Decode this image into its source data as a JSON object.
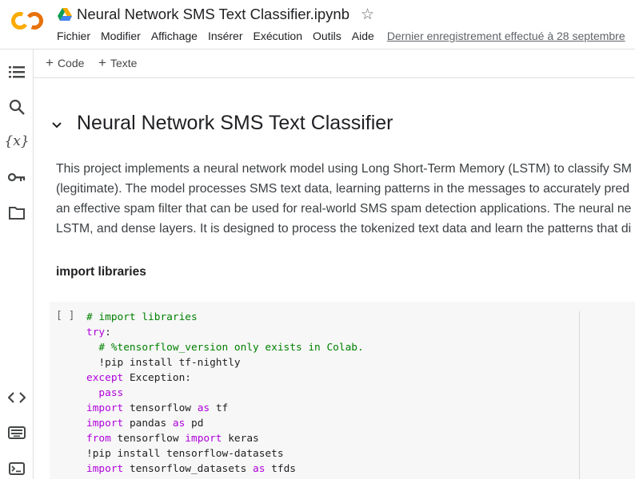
{
  "header": {
    "title": "Neural Network SMS Text Classifier.ipynb",
    "menu": [
      "Fichier",
      "Modifier",
      "Affichage",
      "Insérer",
      "Exécution",
      "Outils",
      "Aide"
    ],
    "last_saved": "Dernier enregistrement effectué à 28 septembre"
  },
  "rail": {
    "icons": [
      "table-of-contents-icon",
      "search-icon",
      "variables-icon",
      "secrets-key-icon",
      "files-folder-icon",
      "code-snippets-icon",
      "command-palette-icon",
      "terminal-icon"
    ]
  },
  "toolbar": {
    "add_code": "Code",
    "add_text": "Texte"
  },
  "notebook": {
    "heading": "Neural Network SMS Text Classifier",
    "paragraph_lines": [
      "This project implements a neural network model using Long Short-Term Memory (LSTM) to classify SM",
      "(legitimate). The model processes SMS text data, learning patterns in the messages to accurately pred",
      "an effective spam filter that can be used for real-world SMS spam detection applications. The neural ne",
      "LSTM, and dense layers. It is designed to process the tokenized text data and learn the patterns that di"
    ],
    "subheading": "import libraries",
    "code_cell": {
      "run_indicator": "[ ]",
      "lines": [
        [
          {
            "t": "# import libraries",
            "c": "cm"
          }
        ],
        [
          {
            "t": "try",
            "c": "kw"
          },
          {
            "t": ":",
            "c": ""
          }
        ],
        [
          {
            "t": "  # %tensorflow_version only exists in Colab.",
            "c": "cm"
          }
        ],
        [
          {
            "t": "  !pip install tf-nightly",
            "c": ""
          }
        ],
        [
          {
            "t": "except",
            "c": "kw"
          },
          {
            "t": " Exception:",
            "c": ""
          }
        ],
        [
          {
            "t": "  pass",
            "c": "kw"
          }
        ],
        [
          {
            "t": "import",
            "c": "kw"
          },
          {
            "t": " tensorflow ",
            "c": ""
          },
          {
            "t": "as",
            "c": "kw"
          },
          {
            "t": " tf",
            "c": ""
          }
        ],
        [
          {
            "t": "import",
            "c": "kw"
          },
          {
            "t": " pandas ",
            "c": ""
          },
          {
            "t": "as",
            "c": "kw"
          },
          {
            "t": " pd",
            "c": ""
          }
        ],
        [
          {
            "t": "from",
            "c": "kw"
          },
          {
            "t": " tensorflow ",
            "c": ""
          },
          {
            "t": "import",
            "c": "kw"
          },
          {
            "t": " keras",
            "c": ""
          }
        ],
        [
          {
            "t": "!pip install tensorflow-datasets",
            "c": ""
          }
        ],
        [
          {
            "t": "import",
            "c": "kw"
          },
          {
            "t": " tensorflow_datasets ",
            "c": ""
          },
          {
            "t": "as",
            "c": "kw"
          },
          {
            "t": " tfds",
            "c": ""
          }
        ]
      ]
    }
  },
  "colors": {
    "accent_orange": "#F9AB00",
    "keyword": "#AF00DB",
    "comment": "#008000"
  }
}
